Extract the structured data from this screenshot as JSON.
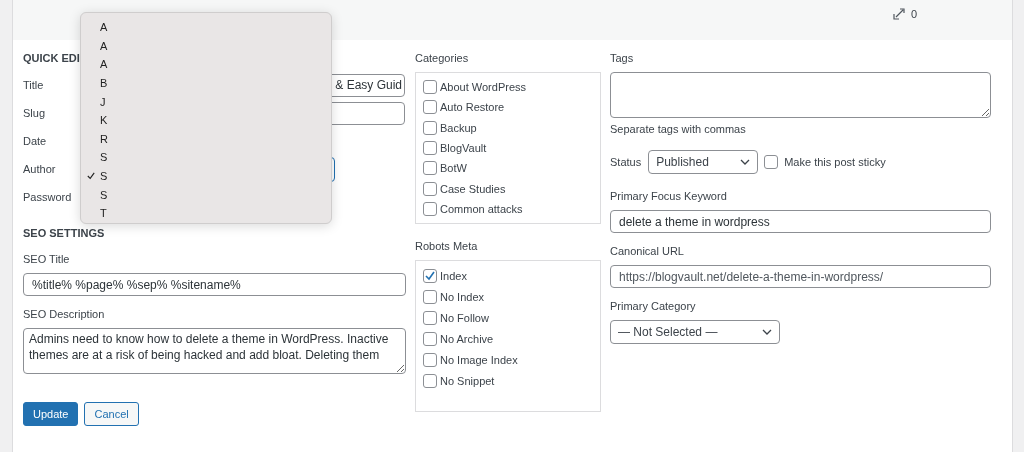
{
  "header": {
    "link_count": "0"
  },
  "quick_edit": {
    "heading": "QUICK EDI",
    "fields": [
      {
        "label": "Title",
        "kind": "text",
        "value": "& Easy Guid"
      },
      {
        "label": "Slug",
        "kind": "text"
      },
      {
        "label": "Date",
        "kind": "none"
      },
      {
        "label": "Author",
        "kind": "select"
      },
      {
        "label": "Password",
        "kind": "none"
      }
    ]
  },
  "author_menu": {
    "options": [
      {
        "label": "A",
        "selected": false
      },
      {
        "label": "A",
        "selected": false
      },
      {
        "label": "A",
        "selected": false
      },
      {
        "label": "B",
        "selected": false
      },
      {
        "label": "J",
        "selected": false
      },
      {
        "label": "K",
        "selected": false
      },
      {
        "label": "R",
        "selected": false
      },
      {
        "label": "S",
        "selected": false
      },
      {
        "label": "S",
        "selected": true
      },
      {
        "label": "S",
        "selected": false
      },
      {
        "label": "T",
        "selected": false
      }
    ]
  },
  "categories": {
    "label": "Categories",
    "items": [
      {
        "label": "About WordPress",
        "checked": false
      },
      {
        "label": "Auto Restore",
        "checked": false
      },
      {
        "label": "Backup",
        "checked": false
      },
      {
        "label": "BlogVault",
        "checked": false
      },
      {
        "label": "BotW",
        "checked": false
      },
      {
        "label": "Case Studies",
        "checked": false
      },
      {
        "label": "Common attacks",
        "checked": false
      }
    ]
  },
  "tags": {
    "label": "Tags",
    "hint": "Separate tags with commas"
  },
  "status": {
    "label": "Status",
    "value": "Published",
    "sticky_label": "Make this post sticky",
    "sticky": false
  },
  "seo": {
    "heading": "SEO SETTINGS",
    "title_label": "SEO Title",
    "title_value": "%title% %page% %sep% %sitename%",
    "description_label": "SEO Description",
    "description_value": "Admins need to know how to delete a theme in WordPress. Inactive themes are at a risk of being hacked and add bloat. Deleting them"
  },
  "robots": {
    "label": "Robots Meta",
    "items": [
      {
        "label": "Index",
        "checked": true
      },
      {
        "label": "No Index",
        "checked": false
      },
      {
        "label": "No Follow",
        "checked": false
      },
      {
        "label": "No Archive",
        "checked": false
      },
      {
        "label": "No Image Index",
        "checked": false
      },
      {
        "label": "No Snippet",
        "checked": false
      }
    ]
  },
  "focus_keyword": {
    "label": "Primary Focus Keyword",
    "value": "delete a theme in wordpress"
  },
  "canonical": {
    "label": "Canonical URL",
    "value": "https://blogvault.net/delete-a-theme-in-wordpress/"
  },
  "primary_category": {
    "label": "Primary Category",
    "value": "— Not Selected —"
  },
  "buttons": [
    {
      "label": "Update",
      "kind": "primary"
    },
    {
      "label": "Cancel",
      "kind": "secondary"
    }
  ]
}
